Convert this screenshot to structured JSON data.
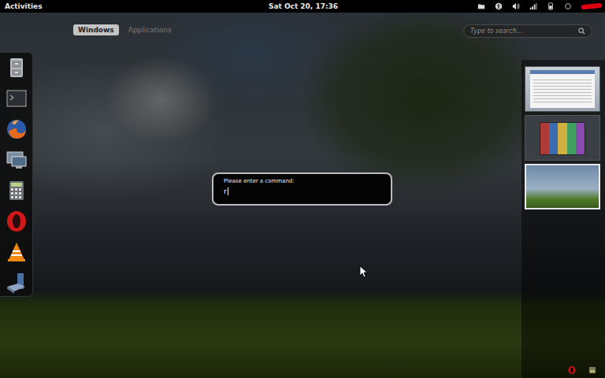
{
  "top_bar": {
    "activities": "Activities",
    "clock": "Sat Oct 20, 17:36"
  },
  "tabs": [
    {
      "label": "Windows",
      "selected": true
    },
    {
      "label": "Applications",
      "selected": false
    }
  ],
  "search": {
    "placeholder": "Type to search..."
  },
  "workspaces": [
    {
      "selected": false
    },
    {
      "selected": false
    },
    {
      "selected": true
    }
  ],
  "run_dialog": {
    "prompt": "Please enter a command:",
    "value": "r"
  }
}
